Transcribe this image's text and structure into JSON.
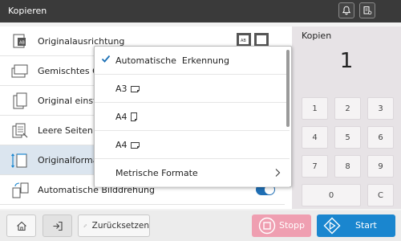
{
  "window": {
    "title": "Kopieren"
  },
  "settings": [
    {
      "label": "Originalausrichtung",
      "icon": "orientation-icon"
    },
    {
      "label": "Gemischtes O",
      "icon": "mixed-original-icon"
    },
    {
      "label": "Original einste",
      "icon": "original-setting-icon"
    },
    {
      "label": "Leere Seiten e",
      "icon": "blank-pages-icon"
    },
    {
      "label": "Originalformat",
      "icon": "original-format-icon"
    },
    {
      "label": "Automatische Bilddrehung",
      "icon": "auto-rotate-icon",
      "toggle_on": true
    }
  ],
  "dropdown": {
    "options": [
      {
        "label": "Automatische  Erkennung",
        "selected": true
      },
      {
        "label": "A3",
        "paper": "landscape-paper-icon"
      },
      {
        "label": "A4",
        "paper": "portrait-paper-icon"
      },
      {
        "label": "A4",
        "paper": "landscape-paper-icon"
      },
      {
        "label": "Metrische Formate",
        "submenu": true
      }
    ]
  },
  "copies": {
    "label": "Kopien",
    "value": "1"
  },
  "keypad": [
    "1",
    "2",
    "3",
    "4",
    "5",
    "6",
    "7",
    "8",
    "9",
    "0",
    "C"
  ],
  "bottom": {
    "reset_label": "Zurücksetzen",
    "stop_label": "Stopp",
    "start_label": "Start"
  },
  "colors": {
    "accent": "#1a86cf",
    "stop": "#ef9fb1",
    "titlebar": "#3a3a3a",
    "active_row": "#dbe5ef"
  }
}
